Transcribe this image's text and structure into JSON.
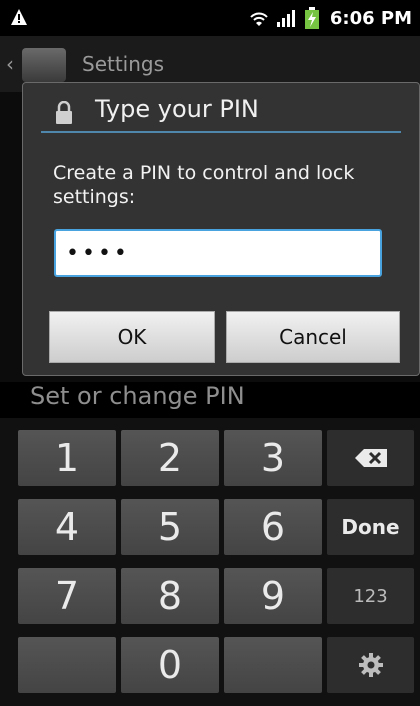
{
  "status_bar": {
    "time": "6:06 PM",
    "icons": [
      "warning-icon",
      "wifi-icon",
      "signal-icon",
      "battery-charging-icon"
    ]
  },
  "app_header": {
    "title": "Settings"
  },
  "dialog": {
    "title": "Type your PIN",
    "message": "Create a PIN to control and lock settings:",
    "pin_value": "••••",
    "ok_label": "OK",
    "cancel_label": "Cancel"
  },
  "below_label": "Set or change PIN",
  "keypad": {
    "rows": [
      [
        "1",
        "2",
        "3",
        "backspace"
      ],
      [
        "4",
        "5",
        "6",
        "Done"
      ],
      [
        "7",
        "8",
        "9",
        "123"
      ],
      [
        "",
        "0",
        "",
        "settings"
      ]
    ],
    "done_label": "Done",
    "mode_label": "123"
  },
  "colors": {
    "accent": "#49a3de",
    "dialog_bg": "#333333",
    "keypad_bg": "#111111"
  }
}
